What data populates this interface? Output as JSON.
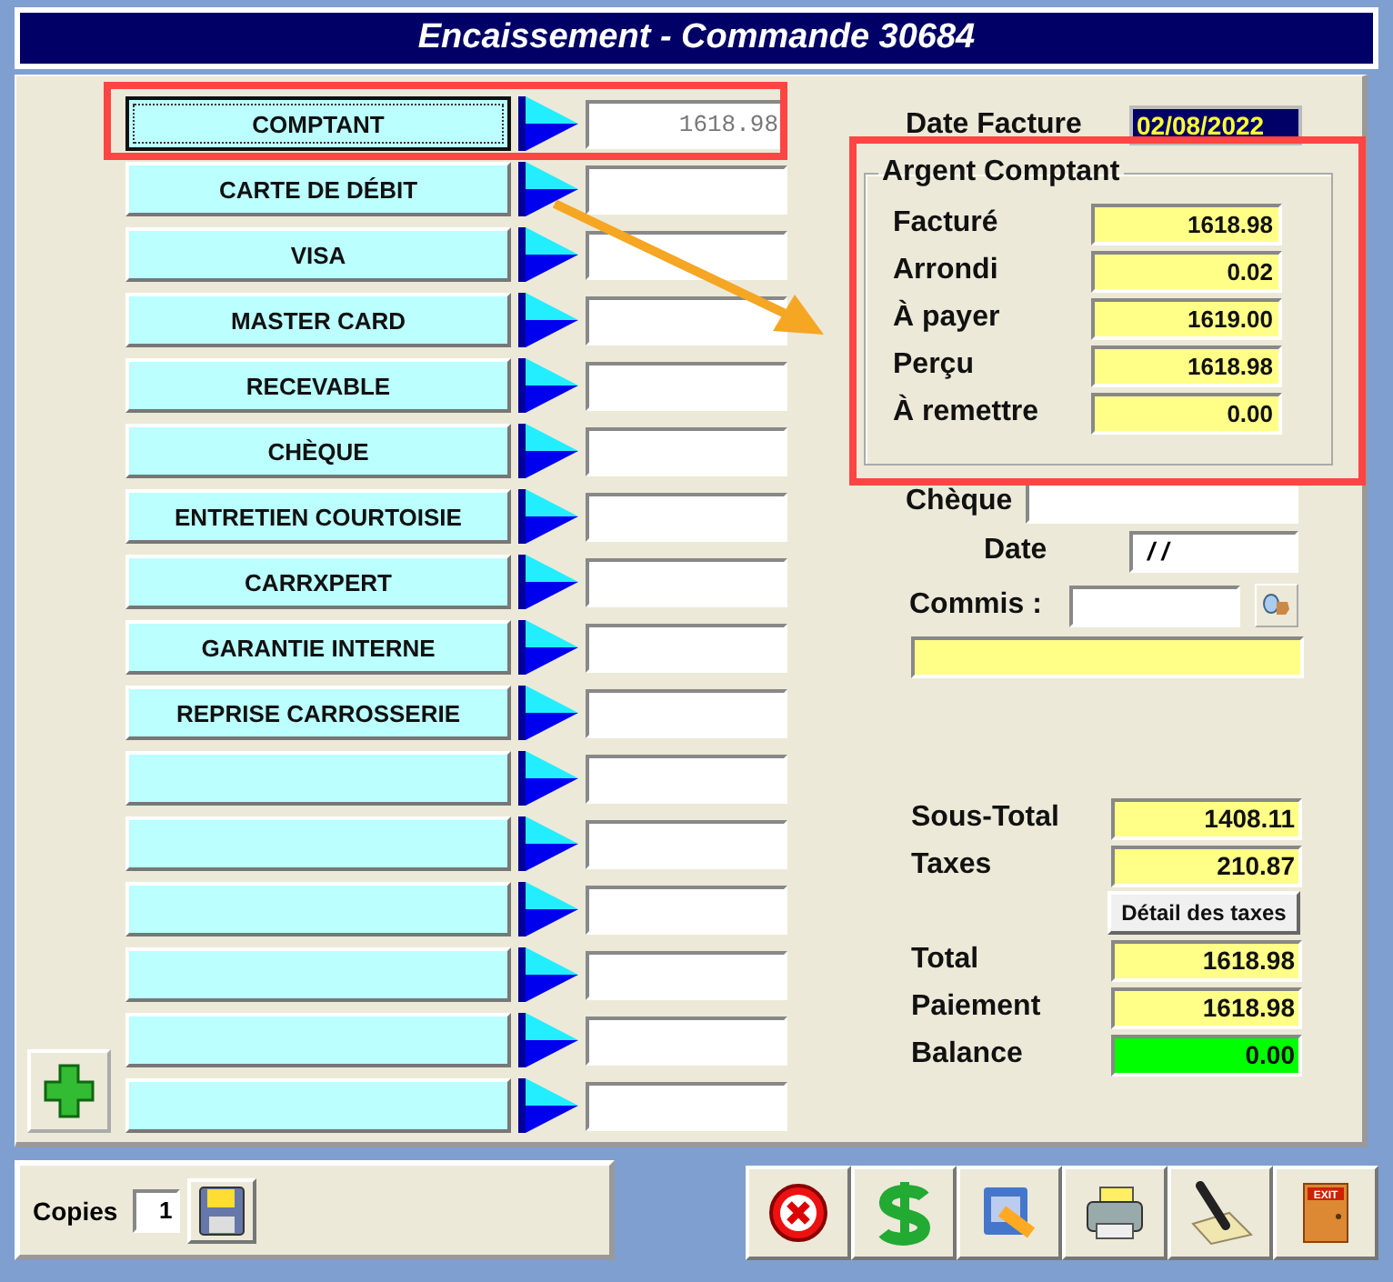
{
  "window": {
    "title": "Encaissement - Commande 30684"
  },
  "payment_methods": [
    {
      "label": "COMPTANT",
      "amount": "1618.98",
      "selected": true
    },
    {
      "label": "CARTE DE DÉBIT",
      "selected": false
    },
    {
      "label": "VISA",
      "selected": false
    },
    {
      "label": "MASTER CARD",
      "selected": false
    },
    {
      "label": "RECEVABLE",
      "selected": false
    },
    {
      "label": "CHÈQUE",
      "selected": false
    },
    {
      "label": "ENTRETIEN COURTOISIE",
      "selected": false
    },
    {
      "label": "CARRXPERT",
      "selected": false
    },
    {
      "label": "GARANTIE INTERNE",
      "selected": false
    },
    {
      "label": "REPRISE CARROSSERIE",
      "selected": false
    },
    {
      "selected": false
    },
    {
      "selected": false
    },
    {
      "selected": false
    },
    {
      "selected": false
    },
    {
      "selected": false
    },
    {
      "selected": false
    }
  ],
  "invoice_date": {
    "label": "Date Facture",
    "value": "02/08/2022"
  },
  "cash": {
    "title": "Argent Comptant",
    "rows": [
      {
        "label": "Facturé",
        "value": "1618.98"
      },
      {
        "label": "Arrondi",
        "value": "0.02"
      },
      {
        "label": "À payer",
        "value": "1619.00"
      },
      {
        "label": "Perçu",
        "value": "1618.98"
      },
      {
        "label": "À remettre",
        "value": "0.00"
      }
    ]
  },
  "cheque": {
    "label": "Chèque"
  },
  "cheque_date": {
    "label": "Date",
    "value": "/ /"
  },
  "clerk": {
    "label": "Commis :"
  },
  "totals": [
    {
      "kind": "field",
      "label": "Sous-Total",
      "value": "1408.11"
    },
    {
      "kind": "field",
      "label": "Taxes",
      "value": "210.87"
    },
    {
      "kind": "button",
      "label": "Détail des taxes"
    },
    {
      "kind": "field",
      "label": "Total",
      "value": "1618.98"
    },
    {
      "kind": "field",
      "label": "Paiement",
      "value": "1618.98"
    },
    {
      "kind": "balance",
      "label": "Balance",
      "value": "0.00"
    }
  ],
  "copies": {
    "label": "Copies",
    "value": "1"
  },
  "toolbar": {
    "exit_label": "EXIT"
  }
}
